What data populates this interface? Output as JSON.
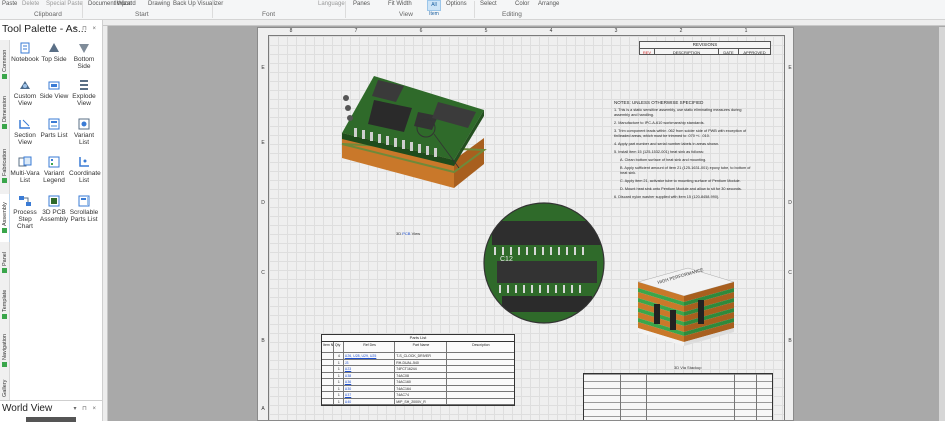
{
  "ribbon": {
    "top_items": [
      "Paste",
      "Delete",
      "Special Paste",
      "Document Wizard",
      "Import",
      "Wizard",
      "Drawing",
      "Back Up Visualizer",
      "Language",
      "Panes",
      "Fit Width",
      "All Item",
      "Options",
      "Selection Select",
      "Arrange Color",
      "Arrange"
    ],
    "panes_label": "Panes",
    "fit_width_label": "Fit Width",
    "all_item_label": "All Item",
    "options_label": "Options",
    "select_label": "Select",
    "color_label": "Color",
    "arrange_label": "Arrange",
    "groups": [
      "Clipboard",
      "Start",
      "Font",
      "View",
      "Editing"
    ]
  },
  "palette": {
    "title": "Tool Palette - As...",
    "controls": "▾ ⊓ ×",
    "tabs": [
      "Common",
      "Dimension",
      "Fabrication",
      "Assembly",
      "Panel",
      "Template",
      "Navigation",
      "Gallery"
    ],
    "tools": [
      {
        "label": "Notebook",
        "icon": "notebook-icon"
      },
      {
        "label": "Top Side",
        "icon": "top-side-icon"
      },
      {
        "label": "Bottom Side",
        "icon": "bottom-side-icon"
      },
      {
        "label": "Custom View",
        "icon": "custom-view-icon"
      },
      {
        "label": "Side View",
        "icon": "side-view-icon"
      },
      {
        "label": "Explode View",
        "icon": "explode-view-icon"
      },
      {
        "label": "Section View",
        "icon": "section-view-icon"
      },
      {
        "label": "Parts List",
        "icon": "parts-list-icon"
      },
      {
        "label": "Variant List",
        "icon": "variant-list-icon"
      },
      {
        "label": "Multi-Vara List",
        "icon": "multi-variant-list-icon"
      },
      {
        "label": "Variant Legend",
        "icon": "variant-legend-icon"
      },
      {
        "label": "Coordinate List",
        "icon": "coordinate-list-icon"
      },
      {
        "label": "Process Step Chart",
        "icon": "process-step-chart-icon"
      },
      {
        "label": "3D PCB Assembly",
        "icon": "pcb-assembly-icon"
      },
      {
        "label": "Scrollable Parts List",
        "icon": "scrollable-parts-list-icon"
      }
    ]
  },
  "world_view": {
    "title": "World View",
    "controls": "▾ ⊓ ×"
  },
  "sheet": {
    "zones_h": [
      "8",
      "7",
      "6",
      "5",
      "4",
      "3",
      "2",
      "1"
    ],
    "zones_v": [
      "E",
      "D",
      "C",
      "B",
      "A"
    ],
    "revisions": {
      "title": "REVISIONS",
      "headers": [
        "REV",
        "DESCRIPTION",
        "DATE",
        "APPROVED"
      ]
    },
    "notes_title": "NOTES: UNLESS OTHERWISE SPECIFIED",
    "notes": [
      "1.  This is a static sensitive assembly, use static eliminating measures during assembly and handling.",
      "2.  Manufacture to IPC-A-610 workmanship standards.",
      "3.  Trim component leads within .062 from solder side of PWB with exception of tin/leaded areas, which must be trimmed to .070 +/- .010.",
      "4.  Apply part number and serial number labels in areas shown.",
      "5.  Install item 15 (125-1532-001) heat sink as follows:",
      "A.  Clean bottom surface of heat sink and mounting.",
      "B.  Apply sufficient amount of item 21 (125-1631-001) epoxy tube, to bottom of heat sink.",
      "C.  Apply item 21, activator tube to mounting surface of Pentium Module.",
      "D.  Mount heat sink onto Pentium Module and allow to sit for 30 seconds.",
      "6.  Discard nylon washer supplied with item 15 (120-8458-990)."
    ],
    "pcb_caption_prefix": "3D ",
    "pcb_caption_link": "PCB",
    "pcb_caption_suffix": " View",
    "stackup_caption": "3D Via Stackup",
    "stackup_label": "HIGH PERFORMANCE",
    "magnifier_label": "C12",
    "parts_list": {
      "title": "Parts List",
      "headers": [
        "Item No",
        "Qty",
        "Ref Des",
        "Part Name",
        "Description"
      ],
      "rows": [
        {
          "item": "",
          "qty": "4",
          "ref": "U26, U28, U29, U25",
          "part": "T-S_CLOCK_DRIVER",
          "desc": ""
        },
        {
          "item": "",
          "qty": "1",
          "ref": "J3",
          "part": "RH-DUAL-540",
          "desc": ""
        },
        {
          "item": "",
          "qty": "1",
          "ref": "U23",
          "part": "74FCT16244",
          "desc": ""
        },
        {
          "item": "",
          "qty": "1",
          "ref": "U38",
          "part": "74AC08",
          "desc": ""
        },
        {
          "item": "",
          "qty": "1",
          "ref": "U36",
          "part": "74AC160",
          "desc": ""
        },
        {
          "item": "",
          "qty": "1",
          "ref": "U30",
          "part": "74AC164",
          "desc": ""
        },
        {
          "item": "",
          "qty": "1",
          "ref": "U37",
          "part": "74AC74",
          "desc": ""
        },
        {
          "item": "",
          "qty": "1",
          "ref": "U40",
          "part": "MIP_SH_2000V_R",
          "desc": ""
        }
      ]
    }
  },
  "colors": {
    "pcb_green": "#2f6a2a",
    "pcb_orange": "#c9782a",
    "accent_blue": "#1d4fd0",
    "tab_green": "#3aa64b"
  }
}
